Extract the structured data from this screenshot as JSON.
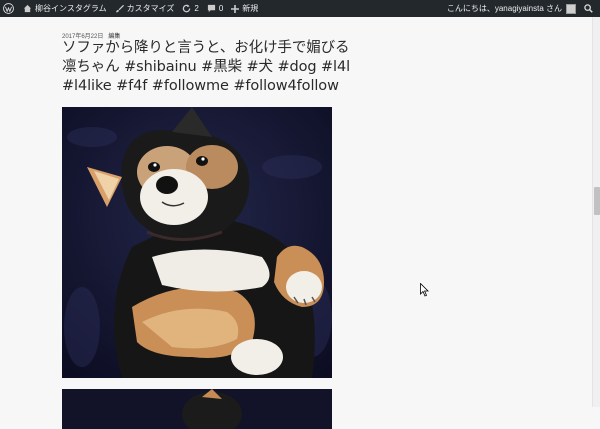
{
  "adminbar": {
    "site_name": "柳谷インスタグラム",
    "customize_label": "カスタマイズ",
    "updates_count": "2",
    "comments_count": "0",
    "new_label": "新規",
    "greeting": "こんにちは、yanagiyainsta さん"
  },
  "post": {
    "date": "2017年6月22日",
    "edit_label": "編集",
    "title": "ソファから降りと言うと、お化け手で媚びる凛ちゃん #shibainu #黒柴 #犬 #dog #l4l #l4like #f4f #followme #follow4follow"
  },
  "colors": {
    "adminbar_bg": "#23282d",
    "page_bg": "#f7f7f7",
    "title_text": "#2a2a2a"
  }
}
